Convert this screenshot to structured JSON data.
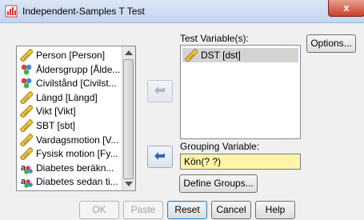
{
  "window": {
    "title": "Independent-Samples T Test",
    "close_label": "x"
  },
  "variables": [
    {
      "label": "Person [Person]",
      "icon": "scale-icon"
    },
    {
      "label": "Åldersgrupp [Ålde...",
      "icon": "nominal-icon"
    },
    {
      "label": "Civilstånd [Civilst...",
      "icon": "nominal-icon"
    },
    {
      "label": "Längd [Längd]",
      "icon": "scale-icon"
    },
    {
      "label": "Vikt [Vikt]",
      "icon": "scale-icon"
    },
    {
      "label": "SBT [sbt]",
      "icon": "scale-icon"
    },
    {
      "label": "Vardagsmotion [V...",
      "icon": "scale-icon"
    },
    {
      "label": "Fysisk motion [Fy...",
      "icon": "scale-icon"
    },
    {
      "label": "Diabetes beräkn...",
      "icon": "nominal-string-icon"
    },
    {
      "label": "Diabetes sedan ti...",
      "icon": "nominal-string-icon"
    }
  ],
  "test_variables": {
    "label": "Test Variable(s):",
    "items": [
      {
        "label": "DST [dst]",
        "icon": "scale-icon"
      }
    ]
  },
  "grouping": {
    "label": "Grouping Variable:",
    "value": "Kön(? ?)",
    "define_groups_label": "Define Groups..."
  },
  "buttons": {
    "options": "Options...",
    "ok": "OK",
    "paste": "Paste",
    "reset": "Reset",
    "cancel": "Cancel",
    "help": "Help"
  }
}
